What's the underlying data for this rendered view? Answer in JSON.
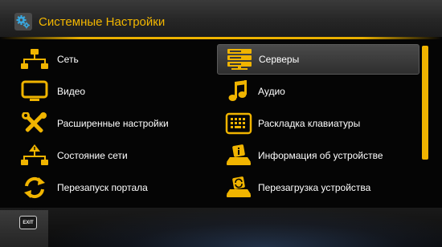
{
  "header": {
    "title": "Системные Настройки",
    "icon": "settings-gears-icon"
  },
  "menu": {
    "left": [
      {
        "label": "Сеть",
        "icon": "network-icon"
      },
      {
        "label": "Видео",
        "icon": "monitor-icon"
      },
      {
        "label": "Расширенные настройки",
        "icon": "tools-icon"
      },
      {
        "label": "Состояние сети",
        "icon": "network-info-icon"
      },
      {
        "label": "Перезапуск портала",
        "icon": "restart-arrows-icon"
      }
    ],
    "right": [
      {
        "label": "Серверы",
        "icon": "servers-icon",
        "selected": true
      },
      {
        "label": "Аудио",
        "icon": "music-note-icon"
      },
      {
        "label": "Раскладка клавиатуры",
        "icon": "keyboard-icon"
      },
      {
        "label": "Информация об устройстве",
        "icon": "device-info-icon"
      },
      {
        "label": "Перезагрузка устройства",
        "icon": "device-reboot-icon"
      }
    ]
  },
  "footer": {
    "exit_label": "EXIT"
  },
  "colors": {
    "accent": "#f0b400",
    "text": "#ffffff",
    "background": "#050505"
  }
}
